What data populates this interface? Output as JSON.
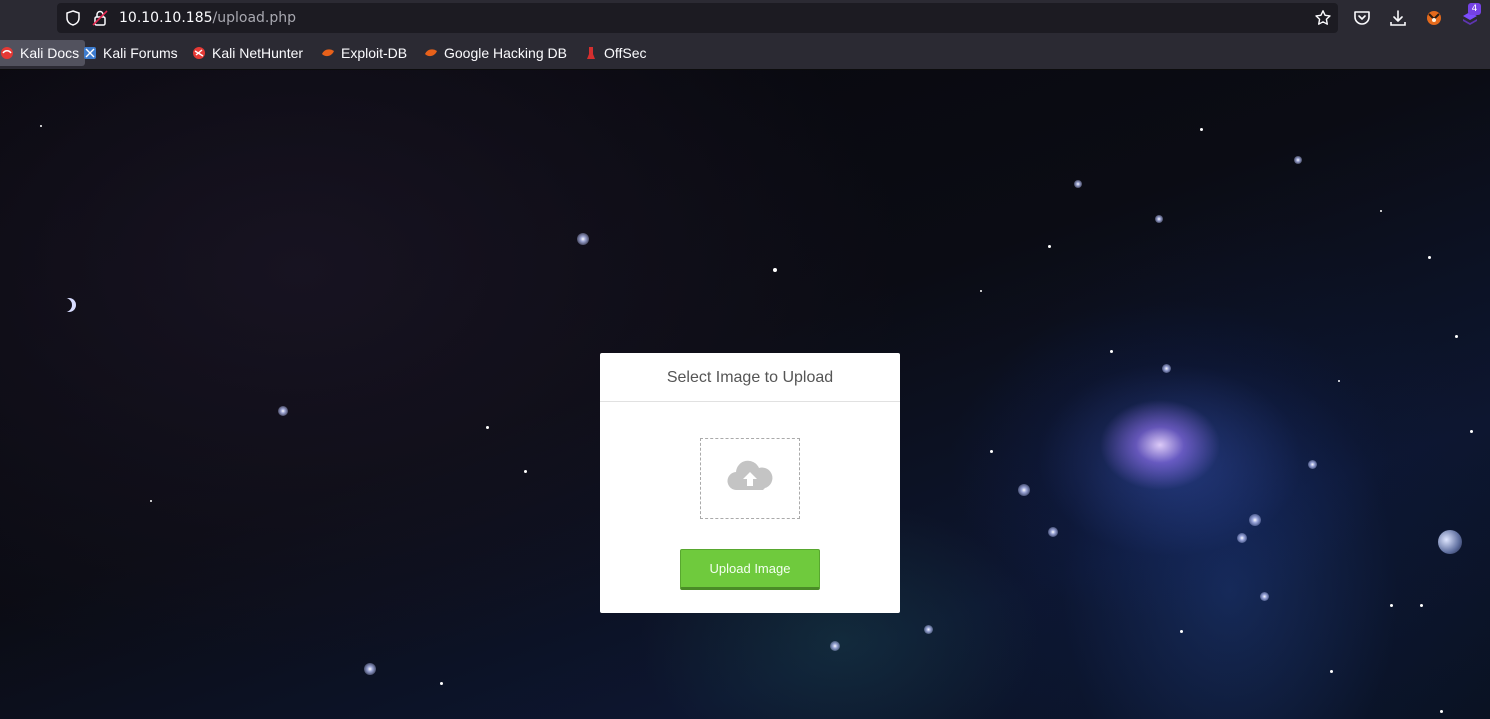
{
  "browser": {
    "url_host": "10.10.10.185",
    "url_path": "/upload.php",
    "extension_badge": "4",
    "bookmarks": [
      {
        "label": "Kali Docs",
        "icon": "kali-docs-icon",
        "color": "#e53935"
      },
      {
        "label": "Kali Forums",
        "icon": "kali-forums-icon",
        "color": "#3d7ccf"
      },
      {
        "label": "Kali NetHunter",
        "icon": "kali-nethunter-icon",
        "color": "#e53935"
      },
      {
        "label": "Exploit-DB",
        "icon": "exploit-db-icon",
        "color": "#e8611a"
      },
      {
        "label": "Google Hacking DB",
        "icon": "google-hacking-db-icon",
        "color": "#e8611a"
      },
      {
        "label": "OffSec",
        "icon": "offsec-icon",
        "color": "#d32f2f"
      }
    ]
  },
  "upload": {
    "title": "Select Image to Upload",
    "dropzone_icon": "cloud-upload-icon",
    "button_label": "Upload Image",
    "button_color": "#6fca3d"
  }
}
